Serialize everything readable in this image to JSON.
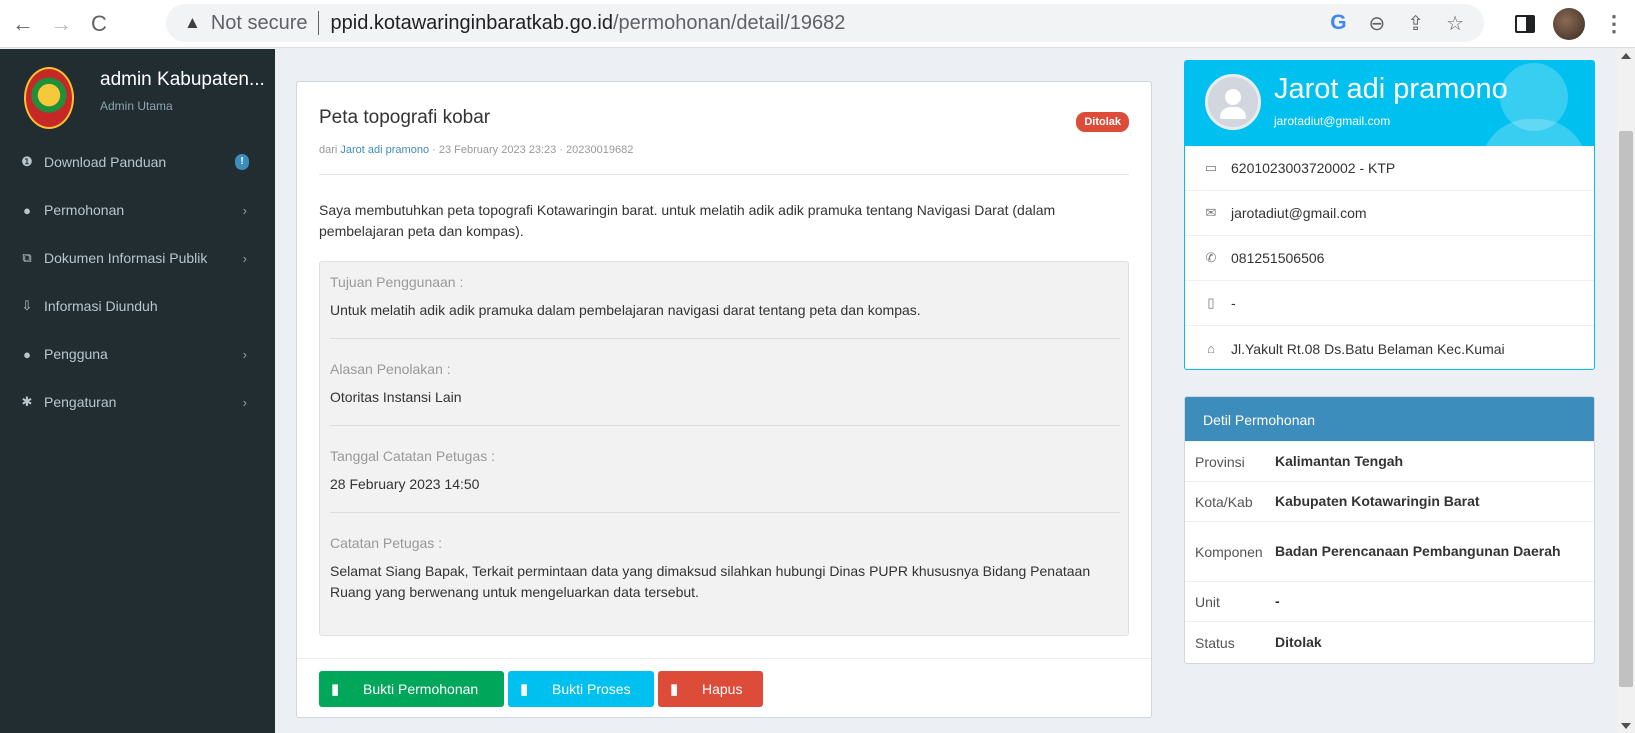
{
  "browser": {
    "back_icon": "←",
    "forward_icon": "→",
    "reload_icon": "C",
    "warning_icon": "▲",
    "security_label": "Not secure",
    "url_host": "ppid.kotawaringinbaratkab.go.id",
    "url_path": "/permohonan/detail/19682",
    "google_icon": "G",
    "zoom_icon": "⊖",
    "share_icon": "⇪",
    "star_icon": "☆",
    "menu_icon": "⋮"
  },
  "sidebar": {
    "user_name": "admin Kabupaten...",
    "user_role": "Admin Utama",
    "items": [
      {
        "label": "Download Panduan",
        "icon": "❶",
        "badge": "!"
      },
      {
        "label": "Permohonan",
        "icon": "●",
        "chevron": "›"
      },
      {
        "label": "Dokumen Informasi Publik",
        "icon": "⧉",
        "chevron": "›"
      },
      {
        "label": "Informasi Diunduh",
        "icon": "⇩"
      },
      {
        "label": "Pengguna",
        "icon": "●",
        "chevron": "›"
      },
      {
        "label": "Pengaturan",
        "icon": "✱",
        "chevron": "›"
      }
    ]
  },
  "request": {
    "title": "Peta topografi kobar",
    "status_badge": "Ditolak",
    "meta_prefix": "dari",
    "meta_author": "Jarot adi pramono",
    "meta_suffix": "· 23 February 2023 23:23 · 20230019682",
    "description": "Saya membutuhkan peta topografi Kotawaringin barat. untuk melatih adik adik pramuka tentang Navigasi Darat (dalam pembelajaran peta dan kompas).",
    "sections": [
      {
        "label": "Tujuan Penggunaan :",
        "value": "Untuk melatih adik adik pramuka dalam pembelajaran navigasi darat tentang peta dan kompas."
      },
      {
        "label": "Alasan Penolakan :",
        "value": "Otoritas Instansi Lain"
      },
      {
        "label": "Tanggal Catatan Petugas :",
        "value": "28 February 2023 14:50"
      },
      {
        "label": "Catatan Petugas :",
        "value": "Selamat Siang Bapak, Terkait permintaan data yang dimaksud silahkan hubungi Dinas PUPR khususnya Bidang Penataan Ruang yang berwenang untuk mengeluarkan data tersebut."
      }
    ],
    "buttons": {
      "bukti_permohonan": "Bukti Permohonan",
      "bukti_proses": "Bukti Proses",
      "hapus": "Hapus"
    }
  },
  "profile": {
    "name": "Jarot adi pramono",
    "email_header": "jarotadiut@gmail.com",
    "rows": [
      {
        "icon": "▭",
        "text": "6201023003720002 - KTP"
      },
      {
        "icon": "✉",
        "text": "jarotadiut@gmail.com"
      },
      {
        "icon": "✆",
        "text": "081251506506"
      },
      {
        "icon": "▯",
        "text": "-"
      },
      {
        "icon": "⌂",
        "text": "Jl.Yakult Rt.08 Ds.Batu Belaman Kec.Kumai"
      }
    ]
  },
  "detail": {
    "header": "Detil Permohonan",
    "rows": [
      {
        "key": "Provinsi",
        "value": "Kalimantan Tengah"
      },
      {
        "key": "Kota/Kab",
        "value": "Kabupaten Kotawaringin Barat"
      },
      {
        "key": "Komponen",
        "value": "Badan Perencanaan Pembangunan Daerah"
      },
      {
        "key": "Unit",
        "value": "-"
      },
      {
        "key": "Status",
        "value": "Ditolak"
      }
    ]
  },
  "colors": {
    "sidebar_bg": "#222d32",
    "success": "#00a65a",
    "info": "#00c0ef",
    "danger": "#dd4b39",
    "primary": "#3c8dbc"
  }
}
